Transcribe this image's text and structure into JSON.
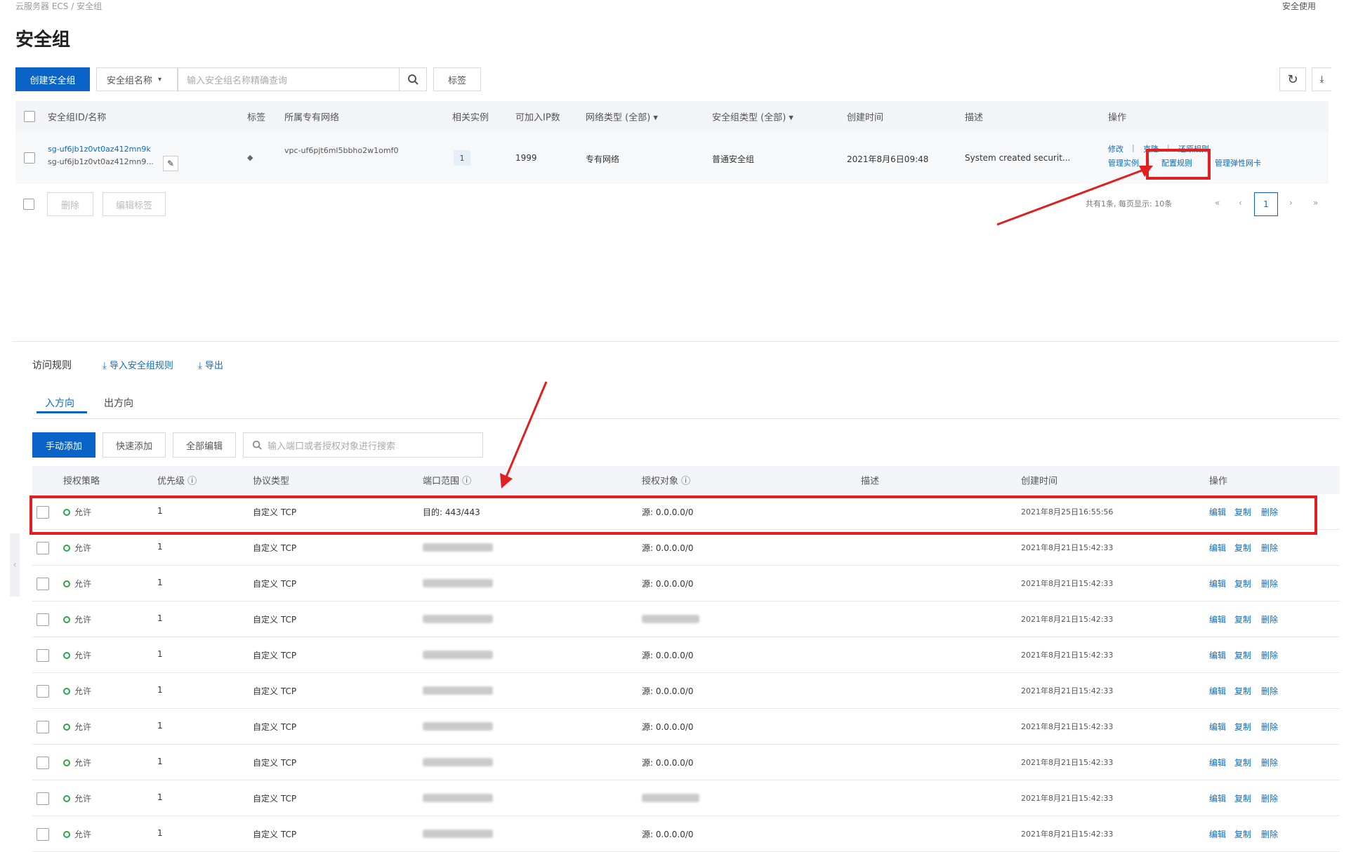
{
  "breadcrumb": "云服务器 ECS / 安全组",
  "top_right": "安全使用",
  "page_title": "安全组",
  "toolbar": {
    "create_btn": "创建安全组",
    "filter_select": "安全组名称",
    "search_placeholder": "输入安全组名称精确查询",
    "tag_btn": "标签"
  },
  "sg_table": {
    "headers": [
      "安全组ID/名称",
      "标签",
      "所属专有网络",
      "相关实例",
      "可加入IP数",
      "网络类型 (全部)",
      "安全组类型 (全部)",
      "创建时间",
      "描述",
      "操作"
    ],
    "row": {
      "id": "sg-uf6jb1z0vt0az412mn9k",
      "name": "sg-uf6jb1z0vt0az412mn9...",
      "vpc": "vpc-uf6pjt6ml5bbho2w1omf0",
      "instances": "1",
      "ip_count": "1999",
      "network": "专有网络",
      "sg_type": "普通安全组",
      "created": "2021年8月6日09:48",
      "desc": "System created securit...",
      "ops": [
        "修改",
        "克隆",
        "还原规则",
        "管理实例",
        "配置规则",
        "管理弹性网卡"
      ]
    },
    "batch_buttons": [
      "删除",
      "编辑标签"
    ],
    "pagination_text": "共有1条, 每页显示: 10条",
    "current_page": "1"
  },
  "rules": {
    "title": "访问规则",
    "import_link": "导入安全组规则",
    "export_link": "导出",
    "tabs": [
      "入方向",
      "出方向"
    ],
    "buttons": [
      "手动添加",
      "快速添加",
      "全部编辑"
    ],
    "search_placeholder": "输入端口或者授权对象进行搜索",
    "headers": [
      "授权策略",
      "优先级",
      "协议类型",
      "端口范围",
      "授权对象",
      "描述",
      "创建时间",
      "操作"
    ],
    "ops": [
      "编辑",
      "复制",
      "删除"
    ],
    "rows": [
      {
        "policy": "允许",
        "priority": "1",
        "protocol": "自定义 TCP",
        "port": "目的: 443/443",
        "source": "源: 0.0.0.0/0",
        "created": "2021年8月25日16:55:56"
      },
      {
        "policy": "允许",
        "priority": "1",
        "protocol": "自定义 TCP",
        "port": "",
        "source": "源: 0.0.0.0/0",
        "created": "2021年8月21日15:42:33"
      },
      {
        "policy": "允许",
        "priority": "1",
        "protocol": "自定义 TCP",
        "port": "",
        "source": "源: 0.0.0.0/0",
        "created": "2021年8月21日15:42:33"
      },
      {
        "policy": "允许",
        "priority": "1",
        "protocol": "自定义 TCP",
        "port": "",
        "source": "",
        "created": "2021年8月21日15:42:33"
      },
      {
        "policy": "允许",
        "priority": "1",
        "protocol": "自定义 TCP",
        "port": "",
        "source": "源: 0.0.0.0/0",
        "created": "2021年8月21日15:42:33"
      },
      {
        "policy": "允许",
        "priority": "1",
        "protocol": "自定义 TCP",
        "port": "",
        "source": "源: 0.0.0.0/0",
        "created": "2021年8月21日15:42:33"
      },
      {
        "policy": "允许",
        "priority": "1",
        "protocol": "自定义 TCP",
        "port": "",
        "source": "源: 0.0.0.0/0",
        "created": "2021年8月21日15:42:33"
      },
      {
        "policy": "允许",
        "priority": "1",
        "protocol": "自定义 TCP",
        "port": "",
        "source": "源: 0.0.0.0/0",
        "created": "2021年8月21日15:42:33"
      },
      {
        "policy": "允许",
        "priority": "1",
        "protocol": "自定义 TCP",
        "port": "",
        "source": "",
        "created": "2021年8月21日15:42:33"
      },
      {
        "policy": "允许",
        "priority": "1",
        "protocol": "自定义 TCP",
        "port": "",
        "source": "源: 0.0.0.0/0",
        "created": "2021年8月21日15:42:33"
      }
    ]
  },
  "colors": {
    "primary": "#0a64c8",
    "link": "#0a6cc4",
    "annotation_red": "#e02020",
    "ok_green": "#2ea44f"
  }
}
